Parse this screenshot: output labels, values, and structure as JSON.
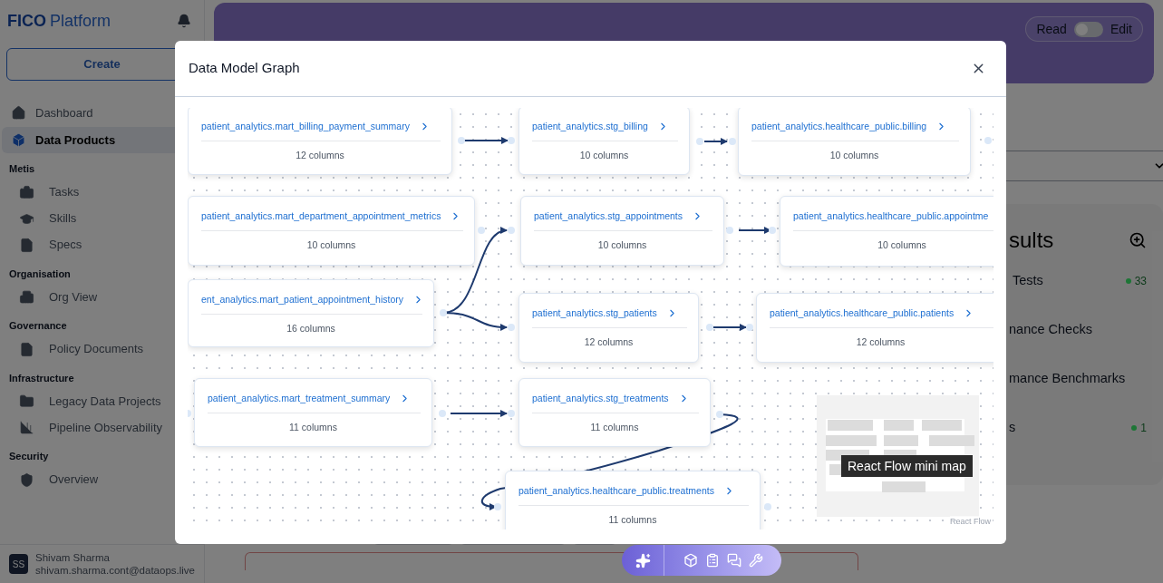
{
  "sidebar": {
    "brand": {
      "bold": "FICO",
      "light": "Platform"
    },
    "create_button": "Create",
    "items": [
      {
        "label": "Dashboard",
        "selected": false
      },
      {
        "label": "Data Products",
        "selected": true
      }
    ],
    "sections": [
      {
        "title": "Metis",
        "items": [
          {
            "label": "Tasks",
            "selected": false
          },
          {
            "label": "Skills",
            "selected": false
          },
          {
            "label": "Specs",
            "selected": false
          }
        ]
      },
      {
        "title": "Organisation",
        "items": [
          {
            "label": "Org View",
            "selected": false
          }
        ]
      },
      {
        "title": "Governance",
        "items": [
          {
            "label": "Policy Documents",
            "selected": false
          }
        ]
      },
      {
        "title": "Infrastructure",
        "items": [
          {
            "label": "Legacy Data Projects",
            "selected": false
          },
          {
            "label": "Pipeline Observability",
            "selected": false
          }
        ]
      },
      {
        "title": "Security",
        "items": [
          {
            "label": "Overview",
            "selected": false
          }
        ]
      }
    ],
    "user": {
      "initials": "SS",
      "name": "Shivam Sharma",
      "email": "shivam.sharma.cont@dataops.live"
    }
  },
  "mode_toggle": {
    "left": "Read",
    "right": "Edit",
    "on": false
  },
  "results": {
    "title": "sults",
    "items": [
      {
        "label": "Tests",
        "count": "33",
        "color": "#1d7636"
      },
      {
        "label": "nance Checks"
      },
      {
        "label": "mance Benchmarks"
      },
      {
        "label": "s",
        "count": "1",
        "color": "#1d7636"
      }
    ]
  },
  "modal": {
    "title": "Data Model Graph",
    "nodes": [
      {
        "title": "patient_analytics.mart_billing_payment_summary",
        "columns": "12 columns"
      },
      {
        "title": "patient_analytics.stg_billing",
        "columns": "10 columns"
      },
      {
        "title": "patient_analytics.healthcare_public.billing",
        "columns": "10 columns"
      },
      {
        "title": "patient_analytics.mart_department_appointment_metrics",
        "columns": "10 columns"
      },
      {
        "title": "patient_analytics.stg_appointments",
        "columns": "10 columns"
      },
      {
        "title": "patient_analytics.healthcare_public.appointme",
        "columns": "10 columns"
      },
      {
        "title": "ent_analytics.mart_patient_appointment_history",
        "columns": "16 columns"
      },
      {
        "title": "patient_analytics.stg_patients",
        "columns": "12 columns"
      },
      {
        "title": "patient_analytics.healthcare_public.patients",
        "columns": "12 columns"
      },
      {
        "title": "patient_analytics.mart_treatment_summary",
        "columns": "11 columns"
      },
      {
        "title": "patient_analytics.stg_treatments",
        "columns": "11 columns"
      },
      {
        "title": "patient_analytics.healthcare_public.treatments",
        "columns": "11 columns"
      }
    ],
    "minimap_tooltip": "React Flow mini map",
    "attribution": "React Flow"
  }
}
